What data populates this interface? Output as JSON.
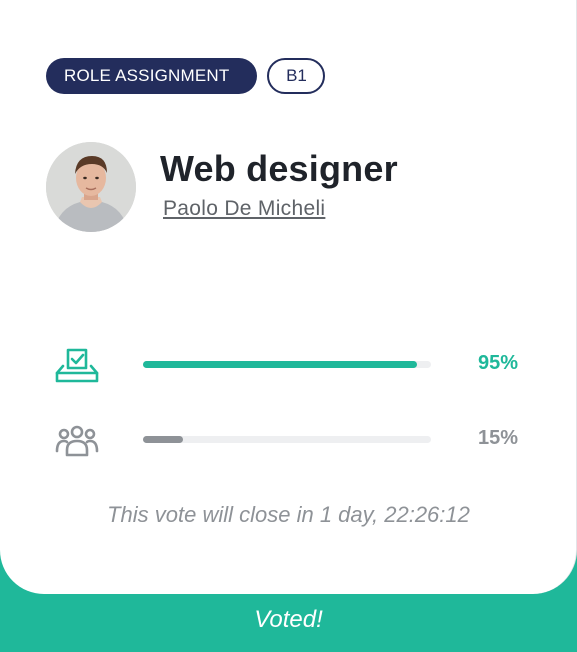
{
  "tags": {
    "role_assignment": "ROLE ASSIGNMENT",
    "level": "B1"
  },
  "role": {
    "title": "Web designer",
    "person": "Paolo De Micheli"
  },
  "votes": [
    {
      "icon": "ballot-box-icon",
      "percent_label": "95%",
      "fraction": 0.95,
      "color": "#1fb89a"
    },
    {
      "icon": "group-users-icon",
      "percent_label": "15%",
      "fraction": 0.15,
      "color": "#8e9297"
    }
  ],
  "closing_text": "This vote will close in 1 day, 22:26:12",
  "status": "Voted!",
  "colors": {
    "accent": "#1fb89a",
    "navy": "#232d5c",
    "muted": "#8e9297"
  }
}
